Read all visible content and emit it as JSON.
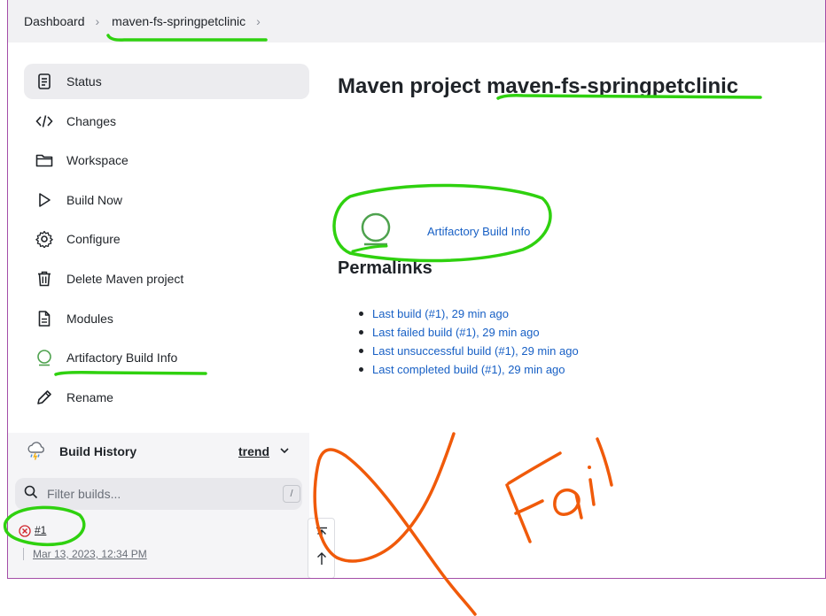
{
  "breadcrumb": {
    "items": [
      "Dashboard",
      "maven-fs-springpetclinic"
    ]
  },
  "sidebar": {
    "items": [
      {
        "label": "Status",
        "icon": "document-icon"
      },
      {
        "label": "Changes",
        "icon": "code-icon"
      },
      {
        "label": "Workspace",
        "icon": "folder-icon"
      },
      {
        "label": "Build Now",
        "icon": "play-icon"
      },
      {
        "label": "Configure",
        "icon": "gear-icon"
      },
      {
        "label": "Delete Maven project",
        "icon": "trash-icon"
      },
      {
        "label": "Modules",
        "icon": "document-icon"
      },
      {
        "label": "Artifactory Build Info",
        "icon": "artifactory-icon"
      },
      {
        "label": "Rename",
        "icon": "pencil-icon"
      }
    ]
  },
  "build_history": {
    "title": "Build History",
    "trend_label": "trend",
    "filter_placeholder": "Filter builds...",
    "filter_shortcut": "/",
    "builds": [
      {
        "number": "#1",
        "timestamp": "Mar 13, 2023, 12:34 PM",
        "status": "failed"
      }
    ]
  },
  "main": {
    "title_prefix": "Maven project",
    "title_project": "maven-fs-springpetclinic",
    "artifactory_link": "Artifactory Build Info",
    "permalinks_title": "Permalinks",
    "permalinks": [
      "Last build (#1), 29 min ago",
      "Last failed build (#1), 29 min ago",
      "Last unsuccessful build (#1), 29 min ago",
      "Last completed build (#1), 29 min ago"
    ]
  },
  "annotations": {
    "handwritten_text": "Fail"
  },
  "colors": {
    "link": "#1860c5",
    "highlight_green": "#2fd10f",
    "annotation_orange": "#f05a0a",
    "fail_red": "#d0242b",
    "artifactory_green": "#4ea24e"
  }
}
